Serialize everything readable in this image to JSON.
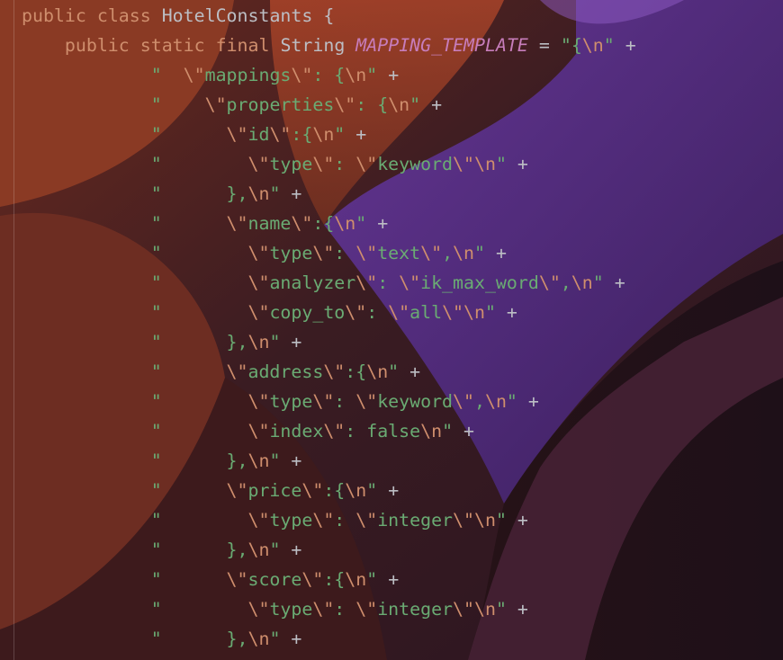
{
  "code": {
    "lines": [
      [
        {
          "t": "public",
          "c": "kw"
        },
        {
          "t": " ",
          "c": "op"
        },
        {
          "t": "class",
          "c": "kw"
        },
        {
          "t": " HotelConstants {",
          "c": "cls"
        }
      ],
      [
        {
          "t": "    ",
          "c": "op"
        },
        {
          "t": "public",
          "c": "kw"
        },
        {
          "t": " ",
          "c": "op"
        },
        {
          "t": "static",
          "c": "kw"
        },
        {
          "t": " ",
          "c": "op"
        },
        {
          "t": "final",
          "c": "kw"
        },
        {
          "t": " String ",
          "c": "cls"
        },
        {
          "t": "MAPPING_TEMPLATE",
          "c": "fld"
        },
        {
          "t": " = ",
          "c": "op"
        },
        {
          "t": "\"{",
          "c": "str"
        },
        {
          "t": "\\n",
          "c": "esc"
        },
        {
          "t": "\"",
          "c": "str"
        },
        {
          "t": " +",
          "c": "op"
        }
      ],
      [
        {
          "t": "            ",
          "c": "op"
        },
        {
          "t": "\"  ",
          "c": "str"
        },
        {
          "t": "\\\"",
          "c": "esc"
        },
        {
          "t": "mappings",
          "c": "str"
        },
        {
          "t": "\\\"",
          "c": "esc"
        },
        {
          "t": ": {",
          "c": "str"
        },
        {
          "t": "\\n",
          "c": "esc"
        },
        {
          "t": "\"",
          "c": "str"
        },
        {
          "t": " +",
          "c": "op"
        }
      ],
      [
        {
          "t": "            ",
          "c": "op"
        },
        {
          "t": "\"    ",
          "c": "str"
        },
        {
          "t": "\\\"",
          "c": "esc"
        },
        {
          "t": "properties",
          "c": "str"
        },
        {
          "t": "\\\"",
          "c": "esc"
        },
        {
          "t": ": {",
          "c": "str"
        },
        {
          "t": "\\n",
          "c": "esc"
        },
        {
          "t": "\"",
          "c": "str"
        },
        {
          "t": " +",
          "c": "op"
        }
      ],
      [
        {
          "t": "            ",
          "c": "op"
        },
        {
          "t": "\"      ",
          "c": "str"
        },
        {
          "t": "\\\"",
          "c": "esc"
        },
        {
          "t": "id",
          "c": "str"
        },
        {
          "t": "\\\"",
          "c": "esc"
        },
        {
          "t": ":{",
          "c": "str"
        },
        {
          "t": "\\n",
          "c": "esc"
        },
        {
          "t": "\"",
          "c": "str"
        },
        {
          "t": " +",
          "c": "op"
        }
      ],
      [
        {
          "t": "            ",
          "c": "op"
        },
        {
          "t": "\"        ",
          "c": "str"
        },
        {
          "t": "\\\"",
          "c": "esc"
        },
        {
          "t": "type",
          "c": "str"
        },
        {
          "t": "\\\"",
          "c": "esc"
        },
        {
          "t": ": ",
          "c": "str"
        },
        {
          "t": "\\\"",
          "c": "esc"
        },
        {
          "t": "keyword",
          "c": "str"
        },
        {
          "t": "\\\"",
          "c": "esc"
        },
        {
          "t": "\\n",
          "c": "esc"
        },
        {
          "t": "\"",
          "c": "str"
        },
        {
          "t": " +",
          "c": "op"
        }
      ],
      [
        {
          "t": "            ",
          "c": "op"
        },
        {
          "t": "\"      },",
          "c": "str"
        },
        {
          "t": "\\n",
          "c": "esc"
        },
        {
          "t": "\"",
          "c": "str"
        },
        {
          "t": " +",
          "c": "op"
        }
      ],
      [
        {
          "t": "            ",
          "c": "op"
        },
        {
          "t": "\"      ",
          "c": "str"
        },
        {
          "t": "\\\"",
          "c": "esc"
        },
        {
          "t": "name",
          "c": "str"
        },
        {
          "t": "\\\"",
          "c": "esc"
        },
        {
          "t": ":{",
          "c": "str"
        },
        {
          "t": "\\n",
          "c": "esc"
        },
        {
          "t": "\"",
          "c": "str"
        },
        {
          "t": " +",
          "c": "op"
        }
      ],
      [
        {
          "t": "            ",
          "c": "op"
        },
        {
          "t": "\"        ",
          "c": "str"
        },
        {
          "t": "\\\"",
          "c": "esc"
        },
        {
          "t": "type",
          "c": "str"
        },
        {
          "t": "\\\"",
          "c": "esc"
        },
        {
          "t": ": ",
          "c": "str"
        },
        {
          "t": "\\\"",
          "c": "esc"
        },
        {
          "t": "text",
          "c": "str"
        },
        {
          "t": "\\\"",
          "c": "esc"
        },
        {
          "t": ",",
          "c": "str"
        },
        {
          "t": "\\n",
          "c": "esc"
        },
        {
          "t": "\"",
          "c": "str"
        },
        {
          "t": " +",
          "c": "op"
        }
      ],
      [
        {
          "t": "            ",
          "c": "op"
        },
        {
          "t": "\"        ",
          "c": "str"
        },
        {
          "t": "\\\"",
          "c": "esc"
        },
        {
          "t": "analyzer",
          "c": "str"
        },
        {
          "t": "\\\"",
          "c": "esc"
        },
        {
          "t": ": ",
          "c": "str"
        },
        {
          "t": "\\\"",
          "c": "esc"
        },
        {
          "t": "ik_max_word",
          "c": "str"
        },
        {
          "t": "\\\"",
          "c": "esc"
        },
        {
          "t": ",",
          "c": "str"
        },
        {
          "t": "\\n",
          "c": "esc"
        },
        {
          "t": "\"",
          "c": "str"
        },
        {
          "t": " +",
          "c": "op"
        }
      ],
      [
        {
          "t": "            ",
          "c": "op"
        },
        {
          "t": "\"        ",
          "c": "str"
        },
        {
          "t": "\\\"",
          "c": "esc"
        },
        {
          "t": "copy_to",
          "c": "str"
        },
        {
          "t": "\\\"",
          "c": "esc"
        },
        {
          "t": ": ",
          "c": "str"
        },
        {
          "t": "\\\"",
          "c": "esc"
        },
        {
          "t": "all",
          "c": "str"
        },
        {
          "t": "\\\"",
          "c": "esc"
        },
        {
          "t": "\\n",
          "c": "esc"
        },
        {
          "t": "\"",
          "c": "str"
        },
        {
          "t": " +",
          "c": "op"
        }
      ],
      [
        {
          "t": "            ",
          "c": "op"
        },
        {
          "t": "\"      },",
          "c": "str"
        },
        {
          "t": "\\n",
          "c": "esc"
        },
        {
          "t": "\"",
          "c": "str"
        },
        {
          "t": " +",
          "c": "op"
        }
      ],
      [
        {
          "t": "            ",
          "c": "op"
        },
        {
          "t": "\"      ",
          "c": "str"
        },
        {
          "t": "\\\"",
          "c": "esc"
        },
        {
          "t": "address",
          "c": "str"
        },
        {
          "t": "\\\"",
          "c": "esc"
        },
        {
          "t": ":{",
          "c": "str"
        },
        {
          "t": "\\n",
          "c": "esc"
        },
        {
          "t": "\"",
          "c": "str"
        },
        {
          "t": " +",
          "c": "op"
        }
      ],
      [
        {
          "t": "            ",
          "c": "op"
        },
        {
          "t": "\"        ",
          "c": "str"
        },
        {
          "t": "\\\"",
          "c": "esc"
        },
        {
          "t": "type",
          "c": "str"
        },
        {
          "t": "\\\"",
          "c": "esc"
        },
        {
          "t": ": ",
          "c": "str"
        },
        {
          "t": "\\\"",
          "c": "esc"
        },
        {
          "t": "keyword",
          "c": "str"
        },
        {
          "t": "\\\"",
          "c": "esc"
        },
        {
          "t": ",",
          "c": "str"
        },
        {
          "t": "\\n",
          "c": "esc"
        },
        {
          "t": "\"",
          "c": "str"
        },
        {
          "t": " +",
          "c": "op"
        }
      ],
      [
        {
          "t": "            ",
          "c": "op"
        },
        {
          "t": "\"        ",
          "c": "str"
        },
        {
          "t": "\\\"",
          "c": "esc"
        },
        {
          "t": "index",
          "c": "str"
        },
        {
          "t": "\\\"",
          "c": "esc"
        },
        {
          "t": ": false",
          "c": "str"
        },
        {
          "t": "\\n",
          "c": "esc"
        },
        {
          "t": "\"",
          "c": "str"
        },
        {
          "t": " +",
          "c": "op"
        }
      ],
      [
        {
          "t": "            ",
          "c": "op"
        },
        {
          "t": "\"      },",
          "c": "str"
        },
        {
          "t": "\\n",
          "c": "esc"
        },
        {
          "t": "\"",
          "c": "str"
        },
        {
          "t": " +",
          "c": "op"
        }
      ],
      [
        {
          "t": "            ",
          "c": "op"
        },
        {
          "t": "\"      ",
          "c": "str"
        },
        {
          "t": "\\\"",
          "c": "esc"
        },
        {
          "t": "price",
          "c": "str"
        },
        {
          "t": "\\\"",
          "c": "esc"
        },
        {
          "t": ":{",
          "c": "str"
        },
        {
          "t": "\\n",
          "c": "esc"
        },
        {
          "t": "\"",
          "c": "str"
        },
        {
          "t": " +",
          "c": "op"
        }
      ],
      [
        {
          "t": "            ",
          "c": "op"
        },
        {
          "t": "\"        ",
          "c": "str"
        },
        {
          "t": "\\\"",
          "c": "esc"
        },
        {
          "t": "type",
          "c": "str"
        },
        {
          "t": "\\\"",
          "c": "esc"
        },
        {
          "t": ": ",
          "c": "str"
        },
        {
          "t": "\\\"",
          "c": "esc"
        },
        {
          "t": "integer",
          "c": "str"
        },
        {
          "t": "\\\"",
          "c": "esc"
        },
        {
          "t": "\\n",
          "c": "esc"
        },
        {
          "t": "\"",
          "c": "str"
        },
        {
          "t": " +",
          "c": "op"
        }
      ],
      [
        {
          "t": "            ",
          "c": "op"
        },
        {
          "t": "\"      },",
          "c": "str"
        },
        {
          "t": "\\n",
          "c": "esc"
        },
        {
          "t": "\"",
          "c": "str"
        },
        {
          "t": " +",
          "c": "op"
        }
      ],
      [
        {
          "t": "            ",
          "c": "op"
        },
        {
          "t": "\"      ",
          "c": "str"
        },
        {
          "t": "\\\"",
          "c": "esc"
        },
        {
          "t": "score",
          "c": "str"
        },
        {
          "t": "\\\"",
          "c": "esc"
        },
        {
          "t": ":{",
          "c": "str"
        },
        {
          "t": "\\n",
          "c": "esc"
        },
        {
          "t": "\"",
          "c": "str"
        },
        {
          "t": " +",
          "c": "op"
        }
      ],
      [
        {
          "t": "            ",
          "c": "op"
        },
        {
          "t": "\"        ",
          "c": "str"
        },
        {
          "t": "\\\"",
          "c": "esc"
        },
        {
          "t": "type",
          "c": "str"
        },
        {
          "t": "\\\"",
          "c": "esc"
        },
        {
          "t": ": ",
          "c": "str"
        },
        {
          "t": "\\\"",
          "c": "esc"
        },
        {
          "t": "integer",
          "c": "str"
        },
        {
          "t": "\\\"",
          "c": "esc"
        },
        {
          "t": "\\n",
          "c": "esc"
        },
        {
          "t": "\"",
          "c": "str"
        },
        {
          "t": " +",
          "c": "op"
        }
      ],
      [
        {
          "t": "            ",
          "c": "op"
        },
        {
          "t": "\"      },",
          "c": "str"
        },
        {
          "t": "\\n",
          "c": "esc"
        },
        {
          "t": "\"",
          "c": "str"
        },
        {
          "t": " +",
          "c": "op"
        }
      ]
    ]
  },
  "colors": {
    "keyword": "#cf8e6d",
    "string": "#6aab73",
    "field": "#c77dbb",
    "text": "#bcbec4"
  }
}
